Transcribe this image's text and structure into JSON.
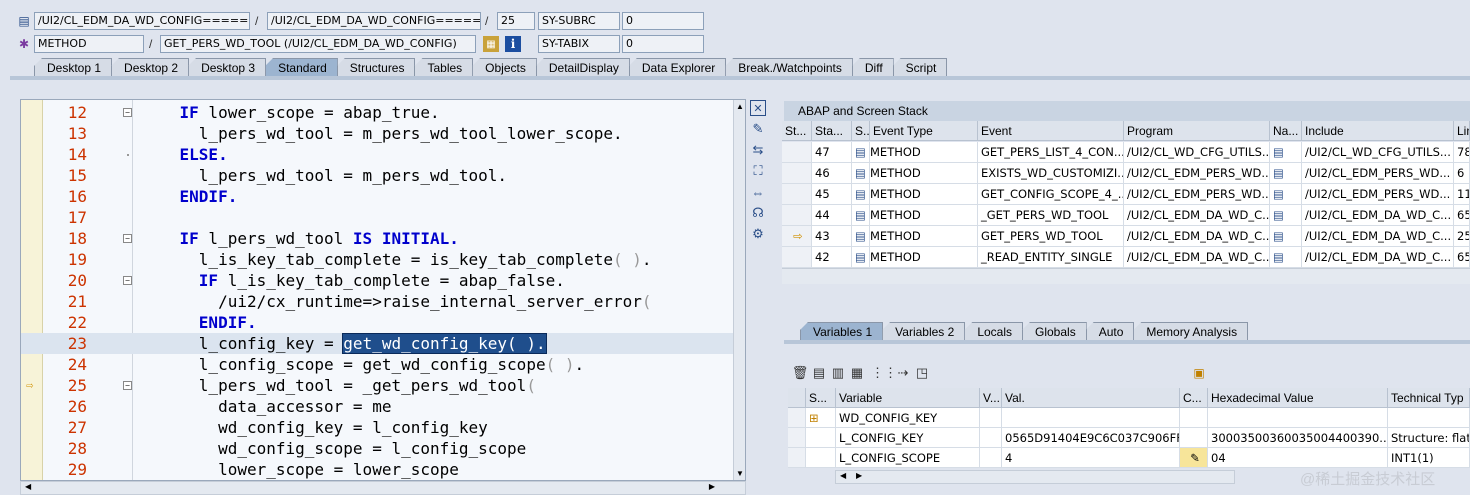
{
  "header": {
    "row1": {
      "program_field": "/UI2/CL_EDM_DA_WD_CONFIG=====...",
      "include_field": "/UI2/CL_EDM_DA_WD_CONFIG=====...",
      "line_field": "25",
      "sy_label": "SY-SUBRC",
      "sy_value": "0"
    },
    "row2": {
      "type_field": "METHOD",
      "method_field": "GET_PERS_WD_TOOL (/UI2/CL_EDM_DA_WD_CONFIG)",
      "sy_label": "SY-TABIX",
      "sy_value": "0"
    },
    "separator": "/"
  },
  "main_tabs": [
    "Desktop 1",
    "Desktop 2",
    "Desktop 3",
    "Standard",
    "Structures",
    "Tables",
    "Objects",
    "DetailDisplay",
    "Data Explorer",
    "Break./Watchpoints",
    "Diff",
    "Script"
  ],
  "main_tabs_active": "Standard",
  "code": {
    "lines": [
      {
        "n": "12",
        "parts": [
          [
            "",
            "    "
          ],
          [
            "kw",
            "IF"
          ],
          [
            "",
            " lower_scope = abap_true."
          ]
        ]
      },
      {
        "n": "13",
        "parts": [
          [
            "",
            "      l_pers_wd_tool = m_pers_wd_tool_lower_scope."
          ]
        ]
      },
      {
        "n": "14",
        "parts": [
          [
            "",
            "    "
          ],
          [
            "kw",
            "ELSE."
          ]
        ]
      },
      {
        "n": "15",
        "parts": [
          [
            "",
            "      l_pers_wd_tool = m_pers_wd_tool."
          ]
        ]
      },
      {
        "n": "16",
        "parts": [
          [
            "",
            "    "
          ],
          [
            "kw",
            "ENDIF."
          ]
        ]
      },
      {
        "n": "17",
        "parts": [
          [
            "",
            ""
          ]
        ]
      },
      {
        "n": "18",
        "parts": [
          [
            "",
            "    "
          ],
          [
            "kw",
            "IF"
          ],
          [
            "",
            " l_pers_wd_tool "
          ],
          [
            "kw",
            "IS INITIAL."
          ]
        ]
      },
      {
        "n": "19",
        "parts": [
          [
            "",
            "      l_is_key_tab_complete = is_key_tab_complete"
          ],
          [
            "paren",
            "( )"
          ],
          [
            "",
            "."
          ]
        ]
      },
      {
        "n": "20",
        "parts": [
          [
            "",
            "      "
          ],
          [
            "kw",
            "IF"
          ],
          [
            "",
            " l_is_key_tab_complete = abap_false."
          ]
        ]
      },
      {
        "n": "21",
        "parts": [
          [
            "",
            "        /ui2/cx_runtime=>raise_internal_server_error"
          ],
          [
            "paren",
            "("
          ]
        ]
      },
      {
        "n": "22",
        "parts": [
          [
            "",
            "      "
          ],
          [
            "kw",
            "ENDIF."
          ]
        ]
      },
      {
        "n": "23",
        "parts": [
          [
            "",
            "      l_config_key = "
          ],
          [
            "sel",
            "get_wd_config_key( )."
          ]
        ]
      },
      {
        "n": "24",
        "parts": [
          [
            "",
            "      l_config_scope = get_wd_config_scope"
          ],
          [
            "paren",
            "( )"
          ],
          [
            "",
            "."
          ]
        ]
      },
      {
        "n": "25",
        "parts": [
          [
            "",
            "      l_pers_wd_tool = _get_pers_wd_tool"
          ],
          [
            "paren",
            "("
          ]
        ]
      },
      {
        "n": "26",
        "parts": [
          [
            "",
            "        data_accessor = me"
          ]
        ]
      },
      {
        "n": "27",
        "parts": [
          [
            "",
            "        wd_config_key = l_config_key"
          ]
        ]
      },
      {
        "n": "28",
        "parts": [
          [
            "",
            "        wd_config_scope = l_config_scope"
          ]
        ]
      },
      {
        "n": "29",
        "parts": [
          [
            "",
            "        lower_scope = lower_scope"
          ]
        ]
      }
    ],
    "highlight_line": "23",
    "current_line": "25"
  },
  "stack": {
    "title": "ABAP and Screen Stack",
    "columns": [
      "St...",
      "Sta...",
      "S...",
      "Event Type",
      "Event",
      "Program",
      "Na...",
      "Include",
      "Lin"
    ],
    "rows": [
      {
        "stack": "47",
        "type": "METHOD",
        "event": "GET_PERS_LIST_4_CON...",
        "program": "/UI2/CL_WD_CFG_UTILS...",
        "include": "/UI2/CL_WD_CFG_UTILS...",
        "line": "78",
        "current": false
      },
      {
        "stack": "46",
        "type": "METHOD",
        "event": "EXISTS_WD_CUSTOMIZI...",
        "program": "/UI2/CL_EDM_PERS_WD...",
        "include": "/UI2/CL_EDM_PERS_WD...",
        "line": "6",
        "current": false
      },
      {
        "stack": "45",
        "type": "METHOD",
        "event": "GET_CONFIG_SCOPE_4_...",
        "program": "/UI2/CL_EDM_PERS_WD...",
        "include": "/UI2/CL_EDM_PERS_WD...",
        "line": "11",
        "current": false
      },
      {
        "stack": "44",
        "type": "METHOD",
        "event": "_GET_PERS_WD_TOOL",
        "program": "/UI2/CL_EDM_DA_WD_C...",
        "include": "/UI2/CL_EDM_DA_WD_C...",
        "line": "65",
        "current": false
      },
      {
        "stack": "43",
        "type": "METHOD",
        "event": "GET_PERS_WD_TOOL",
        "program": "/UI2/CL_EDM_DA_WD_C...",
        "include": "/UI2/CL_EDM_DA_WD_C...",
        "line": "25",
        "current": true
      },
      {
        "stack": "42",
        "type": "METHOD",
        "event": "_READ_ENTITY_SINGLE",
        "program": "/UI2/CL_EDM_DA_WD_C...",
        "include": "/UI2/CL_EDM_DA_WD_C...",
        "line": "65",
        "current": false
      }
    ]
  },
  "var_tabs": [
    "Variables 1",
    "Variables 2",
    "Locals",
    "Globals",
    "Auto",
    "Memory Analysis"
  ],
  "var_tabs_active": "Variables 1",
  "variables": {
    "columns": [
      "S...",
      "Variable",
      "V...",
      "Val.",
      "C...",
      "Hexadecimal Value",
      "Technical Typ"
    ],
    "rows": [
      {
        "name": "WD_CONFIG_KEY",
        "value": "",
        "hex": "",
        "tech": ""
      },
      {
        "name": "L_CONFIG_KEY",
        "value": "0565D91404E9C6C037C906FF...",
        "hex": "30003500360035004400390...",
        "tech": "Structure: flat"
      },
      {
        "name": "L_CONFIG_SCOPE",
        "value": "4",
        "hex": "04",
        "tech": "INT1(1)"
      }
    ]
  },
  "watermark": "@稀土掘金技术社区"
}
